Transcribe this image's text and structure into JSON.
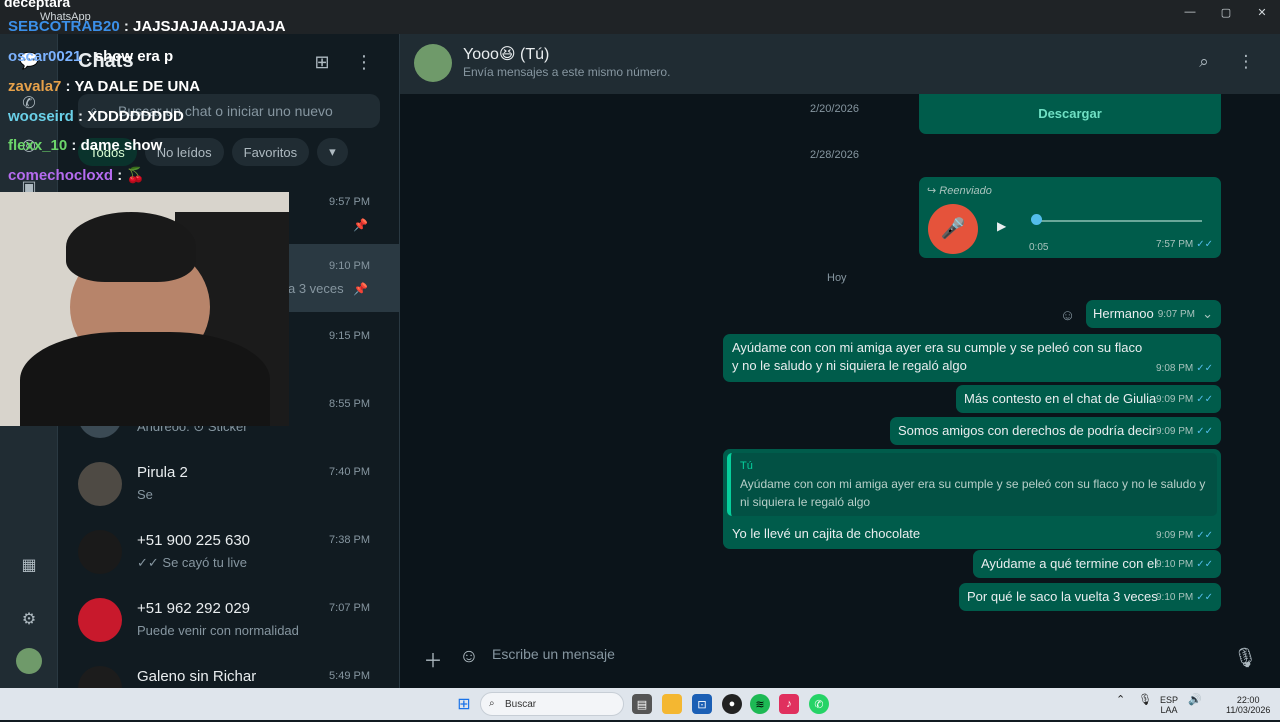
{
  "window": {
    "top_text": "deceptara",
    "app_name": "WhatsApp",
    "minimize": "—",
    "maximize": "▢",
    "close": "✕"
  },
  "rail_icons": [
    "chats-icon",
    "calls-icon",
    "status-icon",
    "gallery-icon",
    "settings-icon"
  ],
  "sidebar": {
    "title": "Chats",
    "search_placeholder": "Buscar un chat o iniciar uno nuevo",
    "filters": [
      "Todos",
      "No leídos",
      "Favoritos"
    ],
    "chats": [
      {
        "name": "",
        "preview": "",
        "time": "9:57 PM",
        "pinned": true
      },
      {
        "name": "",
        "preview": "a 3 veces",
        "time": "9:10 PM",
        "pinned": true
      },
      {
        "name": "",
        "preview": "",
        "time": "9:15 PM",
        "pinned": false
      },
      {
        "name": "",
        "preview": "Andreoo: ⊙ Sticker",
        "time": "8:55 PM",
        "pinned": false
      },
      {
        "name": "Pirula 2",
        "preview": "Se",
        "time": "7:40 PM",
        "pinned": false
      },
      {
        "name": "+51 900 225 630",
        "preview": "✓✓ Se cayó tu live",
        "time": "7:38 PM",
        "pinned": false
      },
      {
        "name": "+51 962 292 029",
        "preview": "Puede venir con normalidad",
        "time": "7:07 PM",
        "pinned": false
      },
      {
        "name": "Galeno sin Richar",
        "preview": "",
        "time": "5:49 PM",
        "pinned": false
      }
    ]
  },
  "chat": {
    "name": "Yooo😆 (Tú)",
    "subtitle": "Envía mensajes a este mismo número.",
    "download_label": "Descargar",
    "dates": [
      "2/20/2026",
      "2/28/2026",
      "Hoy"
    ],
    "forwarded_label": "Reenviado",
    "audio": {
      "duration": "0:05",
      "time": "7:57 PM"
    },
    "messages": [
      {
        "text": "Hermanoo",
        "time": "9:07 PM"
      },
      {
        "text": "Ayúdame con con mi amiga ayer era su cumple y se peleó con su flaco y no le saludo y ni siquiera le regaló algo",
        "time": "9:08 PM"
      },
      {
        "text": "Más contesto en el chat de Giulia",
        "time": "9:09 PM"
      },
      {
        "text": "Somos amigos con derechos de podría decir",
        "time": "9:09 PM"
      },
      {
        "reply_author": "Tú",
        "reply_text": "Ayúdame con con mi amiga ayer era su cumple y se peleó con su flaco y no le saludo y ni siquiera le regaló algo",
        "text": "Yo le llevé un cajita de chocolate",
        "time": "9:09 PM"
      },
      {
        "text": "Ayúdame a qué termine con el",
        "time": "9:10 PM"
      },
      {
        "text": "Por qué le saco la vuelta 3 veces",
        "time": "9:10 PM"
      }
    ],
    "compose_placeholder": "Escribe un mensaje"
  },
  "stream_overlay": {
    "lines": [
      {
        "user": "SEBCOTRAB20",
        "msg": "JAJSJAJAAJJAJAJA",
        "color": "#3b8fe8"
      },
      {
        "user": "oscar0021",
        "msg": "show era p",
        "color": "#7cb3ff"
      },
      {
        "user": "zavala7",
        "msg": "YA DALE DE UNA",
        "color": "#e6a14a"
      },
      {
        "user": "wooseird",
        "msg": "XDDDDDDDD",
        "color": "#6ad0e8"
      },
      {
        "user": "flexx_10",
        "msg": "dame show",
        "color": "#6cd66a"
      },
      {
        "user": "comechocloxd",
        "msg": "🍒",
        "color": "#b66cf0"
      }
    ]
  },
  "taskbar": {
    "search_label": "Buscar",
    "lang": "ESP",
    "lang2": "LAA",
    "clock_time": "22:00",
    "clock_date": "11/03/2026"
  }
}
